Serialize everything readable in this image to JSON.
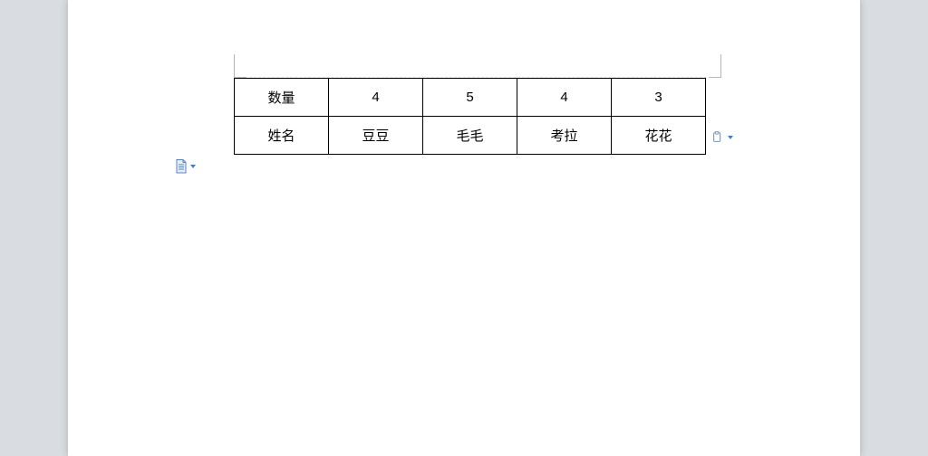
{
  "table": {
    "rows": [
      {
        "label": "数量",
        "cells": [
          "4",
          "5",
          "4",
          "3"
        ]
      },
      {
        "label": "姓名",
        "cells": [
          "豆豆",
          "毛毛",
          "考拉",
          "花花"
        ]
      }
    ]
  }
}
